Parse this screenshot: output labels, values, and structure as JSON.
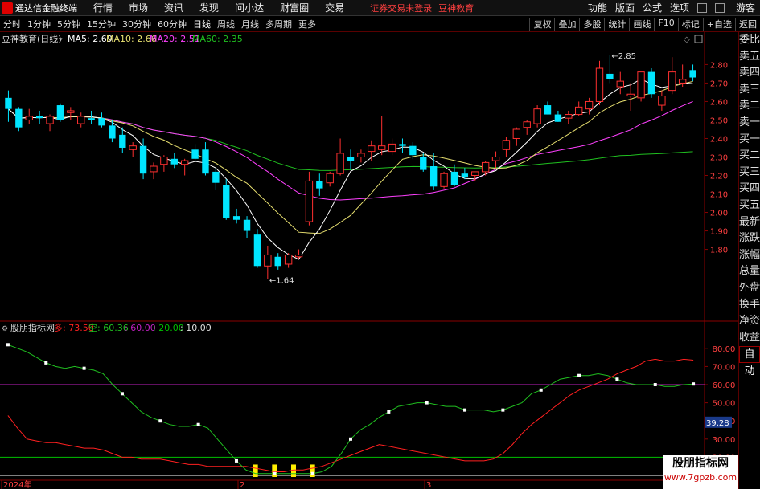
{
  "menubar": {
    "app_title": "通达信金融终端",
    "items": [
      "行情",
      "市场",
      "资讯",
      "发现",
      "问小达",
      "财富圈",
      "交易"
    ],
    "notice": "证券交易未登录",
    "notice2": "豆神教育",
    "right_items": [
      "功能",
      "版面",
      "公式",
      "选项"
    ],
    "guest": "游客"
  },
  "periodbar": {
    "periods": [
      "分时",
      "1分钟",
      "5分钟",
      "15分钟",
      "30分钟",
      "60分钟",
      "日线",
      "周线",
      "月线",
      "多周期",
      "更多"
    ],
    "active": "日线",
    "tools": [
      "复权",
      "叠加",
      "多股",
      "统计",
      "画线",
      "F10",
      "标记",
      "+自选",
      "返回"
    ]
  },
  "sidebar": {
    "items": [
      "委比",
      "卖五",
      "卖四",
      "卖三",
      "卖二",
      "卖一",
      "买一",
      "买二",
      "买三",
      "买四",
      "买五",
      "最新",
      "涨跌",
      "涨幅",
      "总量",
      "外盘",
      "换手",
      "净资",
      "收益"
    ],
    "auto": "自动"
  },
  "main_header": {
    "title": "豆神教育(日线)",
    "ma5": "MA5: 2.69",
    "ma10": "MA10: 2.66",
    "ma20": "MA20: 2.51",
    "ma60": "MA60: 2.35"
  },
  "indicator_header": {
    "title": "股朋指标网",
    "duo": "多: 73.50",
    "kong": "空: 60.36",
    "l60": ": 60.00",
    "l20": ": 20.00",
    "l10": ": 10.00"
  },
  "watermark": {
    "line1": "股朋指标网",
    "line2": "www.7gpzb.com"
  },
  "colors": {
    "up": "#ff3030",
    "down": "#00e5ff",
    "ma5": "#ffffff",
    "ma10": "#e8e070",
    "ma20": "#ff40ff",
    "ma60": "#20c020",
    "duo": "#ff2020",
    "kong": "#20c020",
    "line60": "#c020c0",
    "line20": "#00c000",
    "line10": "#ffffff",
    "cursor_badge": "#1a3a8a"
  },
  "chart_data": [
    {
      "type": "candlestick",
      "title": "豆神教育(日线)",
      "ylim": [
        1.62,
        2.88
      ],
      "y_ticks": [
        "2.80",
        "2.70",
        "2.60",
        "2.50",
        "2.40",
        "2.30",
        "2.20",
        "2.10",
        "2.00",
        "1.90",
        "1.80"
      ],
      "x_labels": [
        "2024年",
        "2",
        "3"
      ],
      "annotations": {
        "high": "2.85",
        "low": "1.64"
      },
      "candles": [
        [
          2.62,
          2.66,
          2.49,
          2.56
        ],
        [
          2.56,
          2.57,
          2.44,
          2.46
        ],
        [
          2.5,
          2.56,
          2.48,
          2.52
        ],
        [
          2.52,
          2.55,
          2.48,
          2.51
        ],
        [
          2.48,
          2.53,
          2.44,
          2.52
        ],
        [
          2.58,
          2.59,
          2.49,
          2.5
        ],
        [
          2.54,
          2.57,
          2.5,
          2.55
        ],
        [
          2.48,
          2.54,
          2.46,
          2.52
        ],
        [
          2.51,
          2.55,
          2.48,
          2.5
        ],
        [
          2.51,
          2.54,
          2.46,
          2.47
        ],
        [
          2.47,
          2.5,
          2.38,
          2.4
        ],
        [
          2.42,
          2.46,
          2.32,
          2.35
        ],
        [
          2.34,
          2.38,
          2.3,
          2.36
        ],
        [
          2.36,
          2.4,
          2.18,
          2.21
        ],
        [
          2.22,
          2.27,
          2.18,
          2.25
        ],
        [
          2.26,
          2.31,
          2.22,
          2.3
        ],
        [
          2.29,
          2.32,
          2.24,
          2.26
        ],
        [
          2.26,
          2.29,
          2.2,
          2.28
        ],
        [
          2.34,
          2.37,
          2.28,
          2.29
        ],
        [
          2.34,
          2.38,
          2.2,
          2.21
        ],
        [
          2.22,
          2.24,
          2.12,
          2.16
        ],
        [
          2.15,
          2.18,
          1.96,
          1.97
        ],
        [
          1.98,
          2.02,
          1.94,
          1.96
        ],
        [
          1.96,
          1.98,
          1.86,
          1.9
        ],
        [
          1.88,
          1.91,
          1.7,
          1.71
        ],
        [
          1.71,
          1.82,
          1.64,
          1.77
        ],
        [
          1.76,
          1.78,
          1.69,
          1.71
        ],
        [
          1.72,
          1.78,
          1.7,
          1.77
        ],
        [
          1.76,
          1.8,
          1.75,
          1.77
        ],
        [
          1.95,
          2.22,
          1.93,
          2.17
        ],
        [
          2.17,
          2.21,
          2.09,
          2.13
        ],
        [
          2.16,
          2.22,
          2.14,
          2.21
        ],
        [
          2.21,
          2.4,
          2.2,
          2.32
        ],
        [
          2.3,
          2.34,
          2.23,
          2.28
        ],
        [
          2.3,
          2.34,
          2.27,
          2.32
        ],
        [
          2.33,
          2.39,
          2.28,
          2.36
        ],
        [
          2.34,
          2.52,
          2.31,
          2.36
        ],
        [
          2.33,
          2.4,
          2.31,
          2.37
        ],
        [
          2.37,
          2.4,
          2.32,
          2.36
        ],
        [
          2.36,
          2.38,
          2.29,
          2.31
        ],
        [
          2.3,
          2.32,
          2.22,
          2.23
        ],
        [
          2.25,
          2.32,
          2.12,
          2.14
        ],
        [
          2.14,
          2.22,
          2.13,
          2.21
        ],
        [
          2.22,
          2.26,
          2.14,
          2.15
        ],
        [
          2.21,
          2.24,
          2.18,
          2.19
        ],
        [
          2.2,
          2.22,
          2.17,
          2.22
        ],
        [
          2.22,
          2.28,
          2.2,
          2.27
        ],
        [
          2.28,
          2.33,
          2.24,
          2.3
        ],
        [
          2.34,
          2.41,
          2.3,
          2.39
        ],
        [
          2.4,
          2.46,
          2.36,
          2.45
        ],
        [
          2.46,
          2.5,
          2.42,
          2.49
        ],
        [
          2.48,
          2.58,
          2.46,
          2.56
        ],
        [
          2.58,
          2.6,
          2.53,
          2.53
        ],
        [
          2.53,
          2.55,
          2.49,
          2.49
        ],
        [
          2.51,
          2.55,
          2.48,
          2.53
        ],
        [
          2.53,
          2.6,
          2.52,
          2.57
        ],
        [
          2.56,
          2.62,
          2.53,
          2.6
        ],
        [
          2.6,
          2.82,
          2.58,
          2.78
        ],
        [
          2.75,
          2.85,
          2.7,
          2.72
        ],
        [
          2.68,
          2.76,
          2.64,
          2.71
        ],
        [
          2.63,
          2.7,
          2.55,
          2.64
        ],
        [
          2.62,
          2.75,
          2.6,
          2.76
        ],
        [
          2.76,
          2.78,
          2.62,
          2.64
        ],
        [
          2.58,
          2.66,
          2.55,
          2.63
        ],
        [
          2.66,
          2.84,
          2.64,
          2.76
        ],
        [
          2.7,
          2.8,
          2.68,
          2.72
        ],
        [
          2.77,
          2.8,
          2.71,
          2.73
        ]
      ]
    },
    {
      "type": "line",
      "title": "股朋指标网",
      "ylim": [
        10,
        87
      ],
      "y_ticks": [
        "80.00",
        "70.00",
        "60.00",
        "50.00",
        "40.00",
        "30.00",
        "20.00"
      ],
      "cursor_value": "39.28",
      "reference_lines": [
        {
          "value": 60,
          "color": "#c020c0"
        },
        {
          "value": 20,
          "color": "#00c000"
        },
        {
          "value": 10,
          "color": "#ffffff"
        }
      ],
      "series": [
        {
          "name": "多",
          "values": [
            43,
            36,
            30,
            29,
            28,
            28,
            27,
            26,
            25,
            25,
            24,
            22,
            20,
            20,
            19,
            19,
            19,
            18,
            17,
            16,
            16,
            15,
            15,
            15,
            15,
            15,
            14,
            13,
            12,
            12,
            13,
            13,
            14,
            15,
            17,
            19,
            21,
            23,
            25,
            27,
            26,
            25,
            24,
            23,
            22,
            21,
            20,
            19,
            18,
            18,
            18,
            19,
            22,
            27,
            33,
            38,
            42,
            46,
            50,
            54,
            57,
            59,
            61,
            63,
            66,
            68,
            70,
            73,
            74,
            73,
            73,
            74,
            73.5
          ]
        },
        {
          "name": "空",
          "values": [
            82,
            80,
            78,
            75,
            72,
            70,
            69,
            70,
            69,
            68,
            66,
            60,
            55,
            50,
            45,
            42,
            40,
            38,
            37,
            37,
            38,
            36,
            30,
            24,
            18,
            13,
            11,
            11,
            11,
            11,
            11,
            11,
            11,
            12,
            15,
            22,
            30,
            35,
            38,
            42,
            45,
            48,
            49,
            50,
            50,
            49,
            48,
            48,
            46,
            46,
            46,
            45,
            46,
            48,
            50,
            55,
            57,
            60,
            63,
            64,
            65,
            65,
            66,
            65,
            63,
            61,
            60,
            60,
            60,
            59,
            59,
            60,
            60.36
          ]
        }
      ]
    }
  ]
}
